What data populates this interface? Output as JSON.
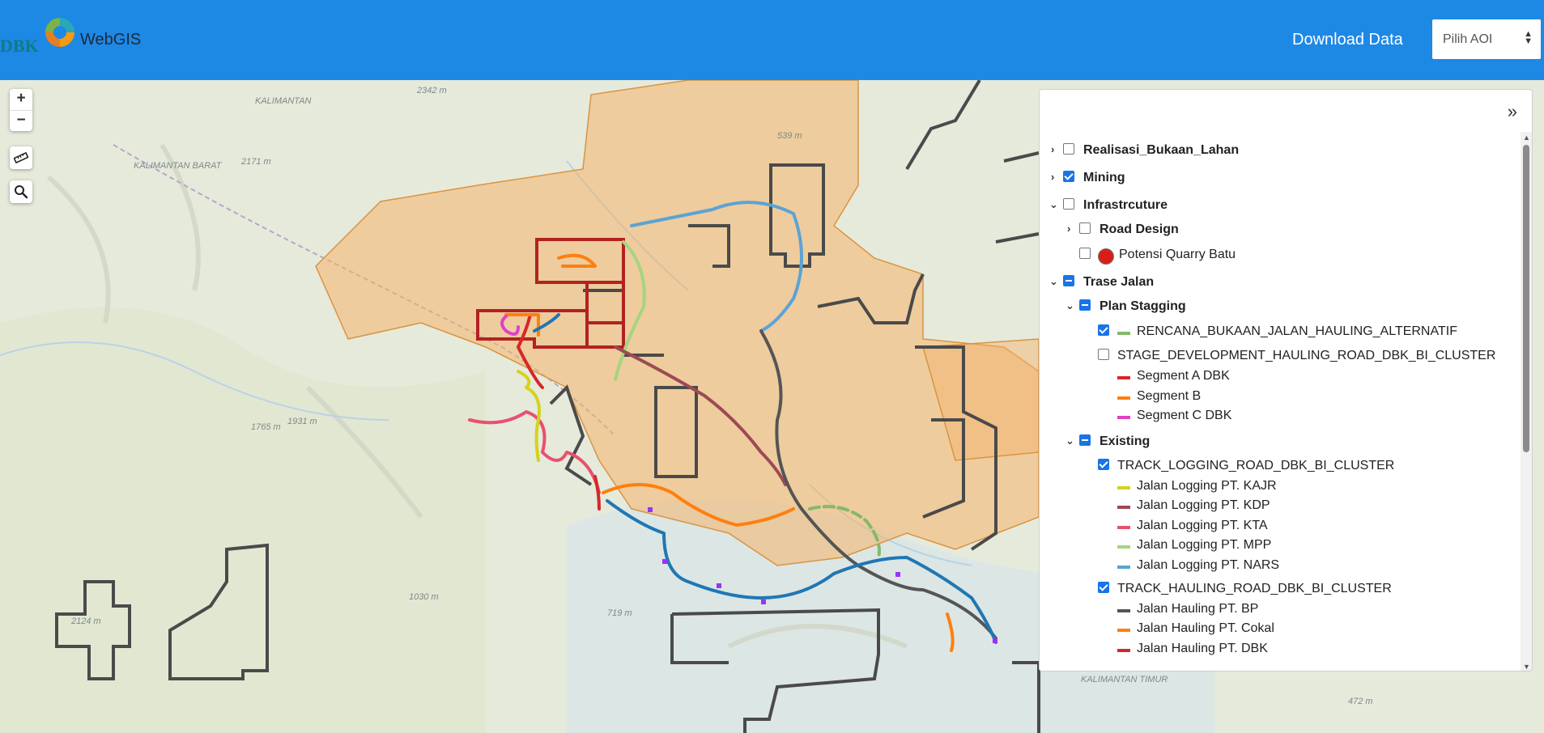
{
  "header": {
    "logo_text": "DBK",
    "app_name": "WebGIS",
    "download_label": "Download Data",
    "aoi_select": "Pilih AOI",
    "background_color": "#1e88e5"
  },
  "map_controls": {
    "zoom_in": "+",
    "zoom_out": "−",
    "measure_icon": "ruler-icon",
    "search_icon": "search-icon"
  },
  "map_labels": [
    {
      "text": "KALIMANTAN"
    },
    {
      "text": "KALIMANTAN BARAT"
    },
    {
      "text": "2342 m"
    },
    {
      "text": "2171 m"
    },
    {
      "text": "539 m"
    },
    {
      "text": "1765 m"
    },
    {
      "text": "1931 m"
    },
    {
      "text": "1030 m"
    },
    {
      "text": "719 m"
    },
    {
      "text": "2124 m"
    },
    {
      "text": "472 m"
    },
    {
      "text": "KALIMANTAN TIMUR"
    }
  ],
  "panel": {
    "collapse_label": "»",
    "layers": [
      {
        "label": "Realisasi_Bukaan_Lahan",
        "checked": false
      },
      {
        "label": "Mining",
        "checked": true
      },
      {
        "label": "Infrastrcuture",
        "checked": false
      },
      {
        "label": "Road Design",
        "checked": false
      },
      {
        "label": "Potensi Quarry Batu",
        "checked": false
      },
      {
        "label": "Trase Jalan",
        "checked": "partial"
      },
      {
        "label": "Plan Stagging",
        "checked": "partial"
      },
      {
        "label": "RENCANA_BUKAAN_JALAN_HAULING_ALTERNATIF",
        "checked": true,
        "color": "#84b96b"
      },
      {
        "label": "STAGE_DEVELOPMENT_HAULING_ROAD_DBK_BI_CLUSTER",
        "checked": false
      },
      {
        "label": "Segment A DBK",
        "color": "#d62728"
      },
      {
        "label": "Segment B",
        "color": "#ff7f0e"
      },
      {
        "label": "Segment C DBK",
        "color": "#e040c8"
      },
      {
        "label": "Existing",
        "checked": "partial"
      },
      {
        "label": "TRACK_LOGGING_ROAD_DBK_BI_CLUSTER",
        "checked": true
      },
      {
        "label": "Jalan Logging PT. KAJR",
        "color": "#d4d21c"
      },
      {
        "label": "Jalan Logging PT. KDP",
        "color": "#9c4a54"
      },
      {
        "label": "Jalan Logging PT. KTA",
        "color": "#e9516d"
      },
      {
        "label": "Jalan Logging PT. MPP",
        "color": "#a7d480"
      },
      {
        "label": "Jalan Logging PT. NARS",
        "color": "#5ba3d4"
      },
      {
        "label": "TRACK_HAULING_ROAD_DBK_BI_CLUSTER",
        "checked": true
      },
      {
        "label": "Jalan Hauling PT. BP",
        "color": "#555555"
      },
      {
        "label": "Jalan Hauling PT. Cokal",
        "color": "#ff7f0e"
      },
      {
        "label": "Jalan Hauling PT. DBK",
        "color": "#d62728"
      }
    ]
  }
}
